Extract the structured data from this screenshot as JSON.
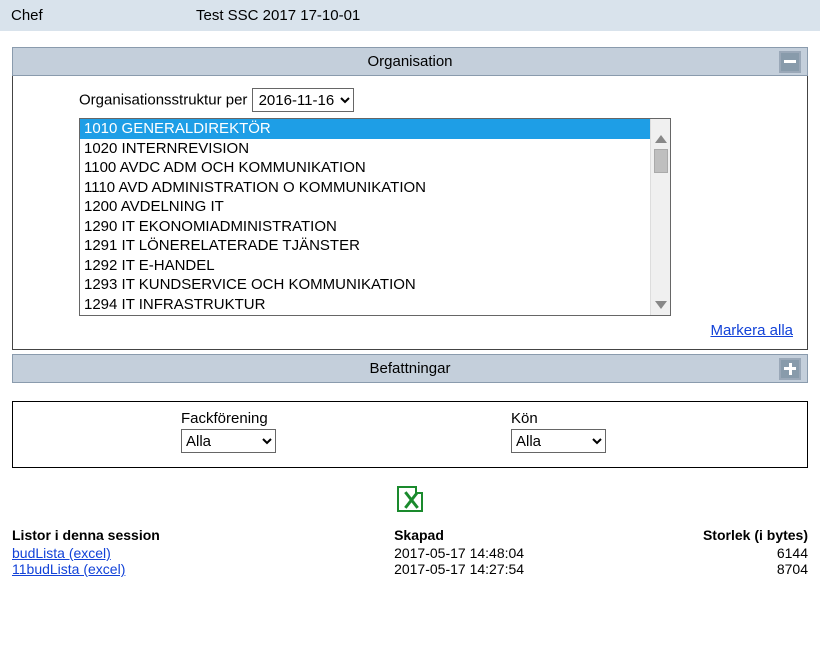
{
  "header": {
    "label": "Chef",
    "value": "Test SSC 2017 17-10-01"
  },
  "organisation": {
    "title": "Organisation",
    "date_label": "Organisationsstruktur per",
    "date_value": "2016-11-16",
    "items": [
      "1010 GENERALDIREKTÖR",
      "1020 INTERNREVISION",
      "1100 AVDC ADM OCH KOMMUNIKATION",
      "1110 AVD ADMINISTRATION O KOMMUNIKATION",
      "1200 AVDELNING IT",
      "1290 IT EKONOMIADMINISTRATION",
      "1291 IT LÖNERELATERADE TJÄNSTER",
      "1292 IT E-HANDEL",
      "1293 IT KUNDSERVICE OCH KOMMUNIKATION",
      "1294 IT INFRASTRUKTUR"
    ],
    "selected_index": 0,
    "mark_all": "Markera alla"
  },
  "befattningar": {
    "title": "Befattningar"
  },
  "filters": {
    "union_label": "Fackförening",
    "union_value": "Alla",
    "gender_label": "Kön",
    "gender_value": "Alla"
  },
  "session": {
    "col_name": "Listor i denna session",
    "col_created": "Skapad",
    "col_size": "Storlek (i bytes)",
    "rows": [
      {
        "name": "budLista (excel)",
        "created": "2017-05-17 14:48:04",
        "size": "6144"
      },
      {
        "name": "11budLista (excel)",
        "created": "2017-05-17 14:27:54",
        "size": "8704"
      }
    ]
  }
}
